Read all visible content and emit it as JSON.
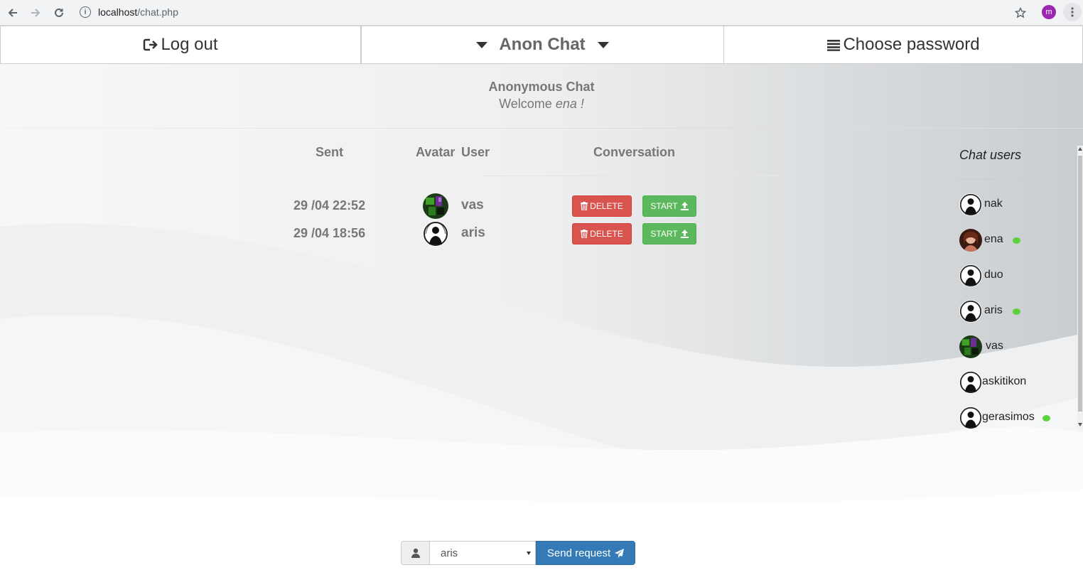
{
  "browser": {
    "url_host": "localhost",
    "url_path": "/chat.php",
    "profile_initial": "m"
  },
  "nav": {
    "logout_label": "Log out",
    "brand_label": "Anon Chat",
    "password_label": "Choose password"
  },
  "header": {
    "title": "Anonymous Chat",
    "welcome_prefix": "Welcome",
    "welcome_user": "ena !"
  },
  "table": {
    "headers": {
      "sent": "Sent",
      "avatar": "Avatar",
      "user": "User",
      "conversation": "Conversation"
    },
    "rows": [
      {
        "sent": "29 /04 22:52",
        "user": "vas",
        "delete_label": "DELETE",
        "start_label": "START"
      },
      {
        "sent": "29 /04 18:56",
        "user": "aris",
        "delete_label": "DELETE",
        "start_label": "START"
      }
    ]
  },
  "sidebar": {
    "title": "Chat users",
    "users": [
      {
        "name": "nak",
        "online": false,
        "avatar": "anon"
      },
      {
        "name": "ena",
        "online": true,
        "avatar": "photo"
      },
      {
        "name": "duo",
        "online": false,
        "avatar": "anon"
      },
      {
        "name": "aris",
        "online": true,
        "avatar": "anon"
      },
      {
        "name": "vas",
        "online": false,
        "avatar": "green"
      },
      {
        "name": "askitikon",
        "online": false,
        "avatar": "anon"
      },
      {
        "name": "gerasimos",
        "online": true,
        "avatar": "anon"
      }
    ]
  },
  "form": {
    "selected_user": "aris",
    "send_label": "Send request"
  },
  "colors": {
    "delete": "#d9534f",
    "start": "#5cb85c",
    "send": "#337ab7",
    "online": "#5cd13c"
  }
}
